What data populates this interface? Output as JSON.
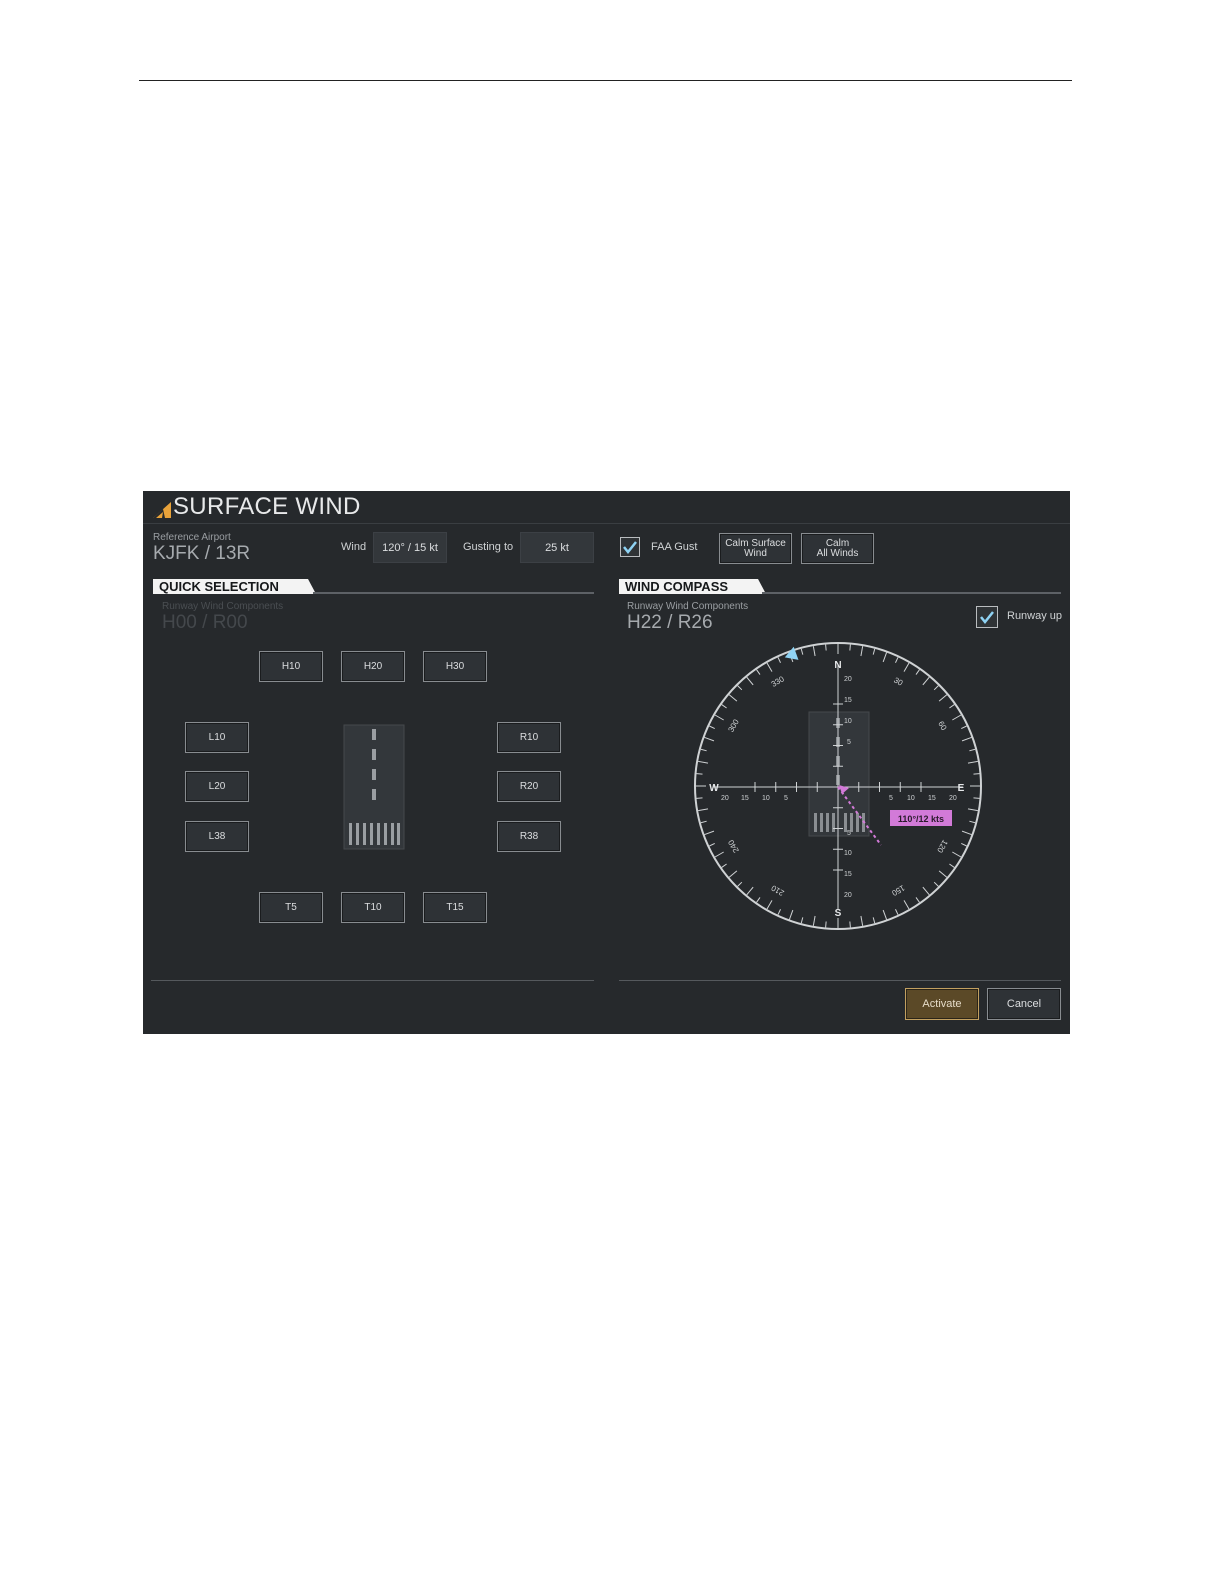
{
  "app": {
    "title": "SURFACE WIND"
  },
  "reference_airport": {
    "label": "Reference Airport",
    "value": "KJFK / 13R"
  },
  "wind": {
    "label": "Wind",
    "value": "120° / 15 kt"
  },
  "gusting": {
    "label": "Gusting to",
    "value": "25 kt"
  },
  "faa_gust": {
    "label": "FAA Gust",
    "checked": true
  },
  "calm_buttons": {
    "calm_surface": "Calm Surface\nWind",
    "calm_all": "Calm\nAll Winds"
  },
  "quick_selection": {
    "title": "QUICK SELECTION",
    "components_label": "Runway Wind Components",
    "components_value": "H00 / R00",
    "buttons": {
      "h10": "H10",
      "h20": "H20",
      "h30": "H30",
      "l10": "L10",
      "l20": "L20",
      "l38": "L38",
      "r10": "R10",
      "r20": "R20",
      "r38": "R38",
      "t5": "T5",
      "t10": "T10",
      "t15": "T15"
    }
  },
  "wind_compass": {
    "title": "WIND COMPASS",
    "components_label": "Runway Wind Components",
    "components_value": "H22 / R26",
    "runway_up": {
      "label": "Runway up",
      "checked": true
    },
    "cardinals": {
      "n": "N",
      "e": "E",
      "s": "S",
      "w": "W"
    },
    "heading_labels": [
      "30",
      "60",
      "120",
      "150",
      "210",
      "240",
      "300",
      "330"
    ],
    "scale_values": [
      "5",
      "10",
      "15",
      "20"
    ],
    "wind_readout": "110°/12 kts",
    "runway_heading_deg": 130,
    "wind_direction_deg": 110,
    "wind_speed_kt": 12
  },
  "actions": {
    "activate": "Activate",
    "cancel": "Cancel"
  },
  "colors": {
    "background": "#26292c",
    "accent_wind": "#d27ad8",
    "accent_heading": "#8fd3f4",
    "activate_border": "#c2a060",
    "logo": "#e8a23a"
  }
}
